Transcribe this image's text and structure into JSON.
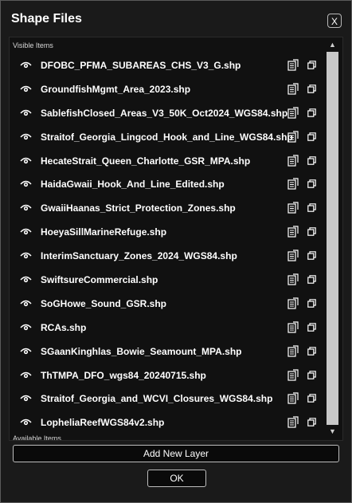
{
  "window": {
    "title": "Shape Files",
    "close_label": "X"
  },
  "list": {
    "visible_label": "Visible Items",
    "available_label": "Available Items",
    "items": [
      {
        "label": "DFOBC_PFMA_SUBAREAS_CHS_V3_G.shp"
      },
      {
        "label": "GroundfishMgmt_Area_2023.shp"
      },
      {
        "label": "SablefishClosed_Areas_V3_50K_Oct2024_WGS84.shp"
      },
      {
        "label": "Straitof_Georgia_Lingcod_Hook_and_Line_WGS84.shp"
      },
      {
        "label": "HecateStrait_Queen_Charlotte_GSR_MPA.shp"
      },
      {
        "label": "HaidaGwaii_Hook_And_Line_Edited.shp"
      },
      {
        "label": "GwaiiHaanas_Strict_Protection_Zones.shp"
      },
      {
        "label": "HoeyaSillMarineRefuge.shp"
      },
      {
        "label": "InterimSanctuary_Zones_2024_WGS84.shp"
      },
      {
        "label": "SwiftsureCommercial.shp"
      },
      {
        "label": "SoGHowe_Sound_GSR.shp"
      },
      {
        "label": "RCAs.shp"
      },
      {
        "label": "SGaanKinghlas_Bowie_Seamount_MPA.shp"
      },
      {
        "label": "ThTMPA_DFO_wgs84_20240715.shp"
      },
      {
        "label": "Straitof_Georgia_and_WCVI_Closures_WGS84.shp"
      },
      {
        "label": "LopheliaReefWGS84v2.shp"
      }
    ],
    "scroll_up": "▲",
    "scroll_down": "▼"
  },
  "buttons": {
    "add_layer": "Add New Layer",
    "ok": "OK"
  },
  "icons": {
    "visibility": "eye-icon",
    "properties": "layer-properties-icon",
    "copy": "copy-icon"
  },
  "colors": {
    "background": "#1a1a1a",
    "list_background": "#111111",
    "scroll_thumb": "#c8c8c8"
  }
}
